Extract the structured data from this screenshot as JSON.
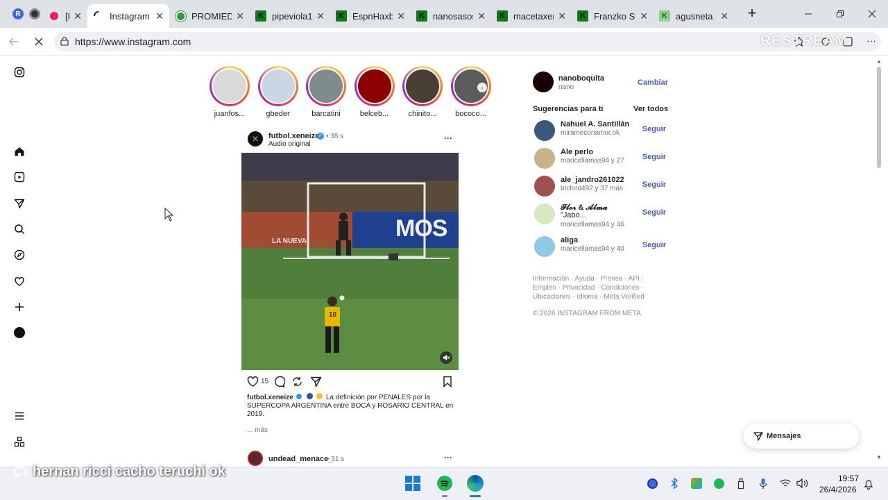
{
  "browser": {
    "tabs": [
      {
        "title": "[LIV",
        "fav": "rec",
        "active": false
      },
      {
        "title": "Instagram",
        "fav": "loading",
        "active": true
      },
      {
        "title": "PROMIEDO",
        "fav": "ball",
        "active": false
      },
      {
        "title": "pipeviola1",
        "fav": "k",
        "active": false
      },
      {
        "title": "EspnHaxba",
        "fav": "k",
        "active": false
      },
      {
        "title": "nanosasos",
        "fav": "k",
        "active": false
      },
      {
        "title": "macetaxen",
        "fav": "k",
        "active": false
      },
      {
        "title": "Franzko Str",
        "fav": "k",
        "active": false
      },
      {
        "title": "agusneta S",
        "fav": "k-light",
        "active": false
      }
    ],
    "url": "https://www.instagram.com",
    "watermark": "RESTREAM"
  },
  "stories": [
    {
      "name": "juanfos...",
      "color": "#d9d9d9"
    },
    {
      "name": "gbeder",
      "color": "#c9d6e3"
    },
    {
      "name": "barcatini",
      "color": "#7f8c8d"
    },
    {
      "name": "belceb...",
      "color": "#8b0000"
    },
    {
      "name": "chinito...",
      "color": "#4a3f35"
    },
    {
      "name": "bococo...",
      "color": "#5c5c5c"
    }
  ],
  "post": {
    "username": "futbol.xeneize",
    "time": "• 38 s",
    "audio": "Audio original",
    "likes": "15",
    "caption_user": "futbol.xeneize",
    "caption": "La definición por PENALES por la SUPERCOPA ARGENTINA entre BOCA y ROSARIO CENTRAL en 2019.",
    "more": "... más",
    "video_ad_text": "MOS",
    "video_banner": "LA NUEVA",
    "player_number": "10"
  },
  "next_post": {
    "username": "undead_menace_",
    "time": "• 31 s"
  },
  "profile": {
    "username": "nanoboquita",
    "fullname": "nano",
    "switch_label": "Cambiar"
  },
  "suggestions": {
    "title": "Sugerencias para ti",
    "see_all": "Ver todos",
    "follow_label": "Seguir",
    "items": [
      {
        "name": "Nahuel A. Santillán",
        "sub": "mirameconamor.ok",
        "color": "#3a5a7a"
      },
      {
        "name": "Ale perlo",
        "sub": "maricellamas94 y 27",
        "color": "#c8b28a"
      },
      {
        "name": "ale_jandro261022",
        "sub": "btclord492 y 37 más",
        "color": "#a05050"
      },
      {
        "name": "𝓕𝓵𝓸𝓻 & 𝓐𝓵𝓶𝓪",
        "name2": "\"Jabo...",
        "sub": "maricellamas94 y 46",
        "color": "#d9e8c0"
      },
      {
        "name": "aliga",
        "sub": "maricellamas94 y 40",
        "color": "#8fc9e6"
      }
    ]
  },
  "footer": {
    "line1": "Información · Ayuda · Prensa · API ·",
    "line2": "Empleo · Privacidad · Condiciones ·",
    "line3": "Ubicaciones · Idioma · Meta Verified",
    "copyright": "© 2026 INSTAGRAM FROM META"
  },
  "messages_label": "Mensajes",
  "caption_overlay": "hernan ricci cacho teruchi ok",
  "taskbar": {
    "time": "19:57",
    "date": "26/4/2026"
  }
}
